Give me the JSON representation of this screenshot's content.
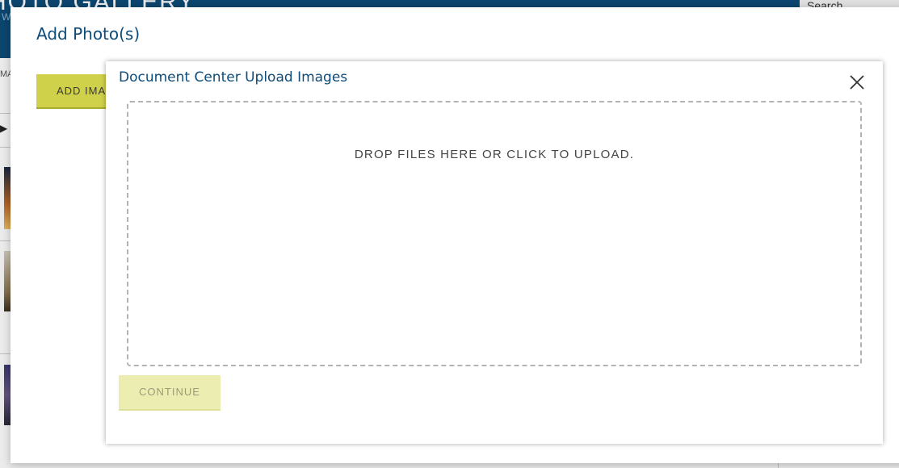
{
  "background": {
    "header_title": "HOTO GALLERY",
    "header_sub": "W",
    "search_label": "Search",
    "left_text": "MA",
    "left_arrow": "▶"
  },
  "outer_modal": {
    "title": "Add Photo(s)",
    "add_images_label": "ADD IMAGES"
  },
  "inner_modal": {
    "title": "Document Center Upload Images",
    "close_icon": "close-icon",
    "dropzone_message": "DROP FILES HERE OR CLICK TO UPLOAD.",
    "continue_label": "CONTINUE"
  },
  "colors": {
    "brand_blue": "#0e4b78",
    "accent_yellow": "#cfd14a",
    "disabled_yellow": "#ecedb1"
  }
}
